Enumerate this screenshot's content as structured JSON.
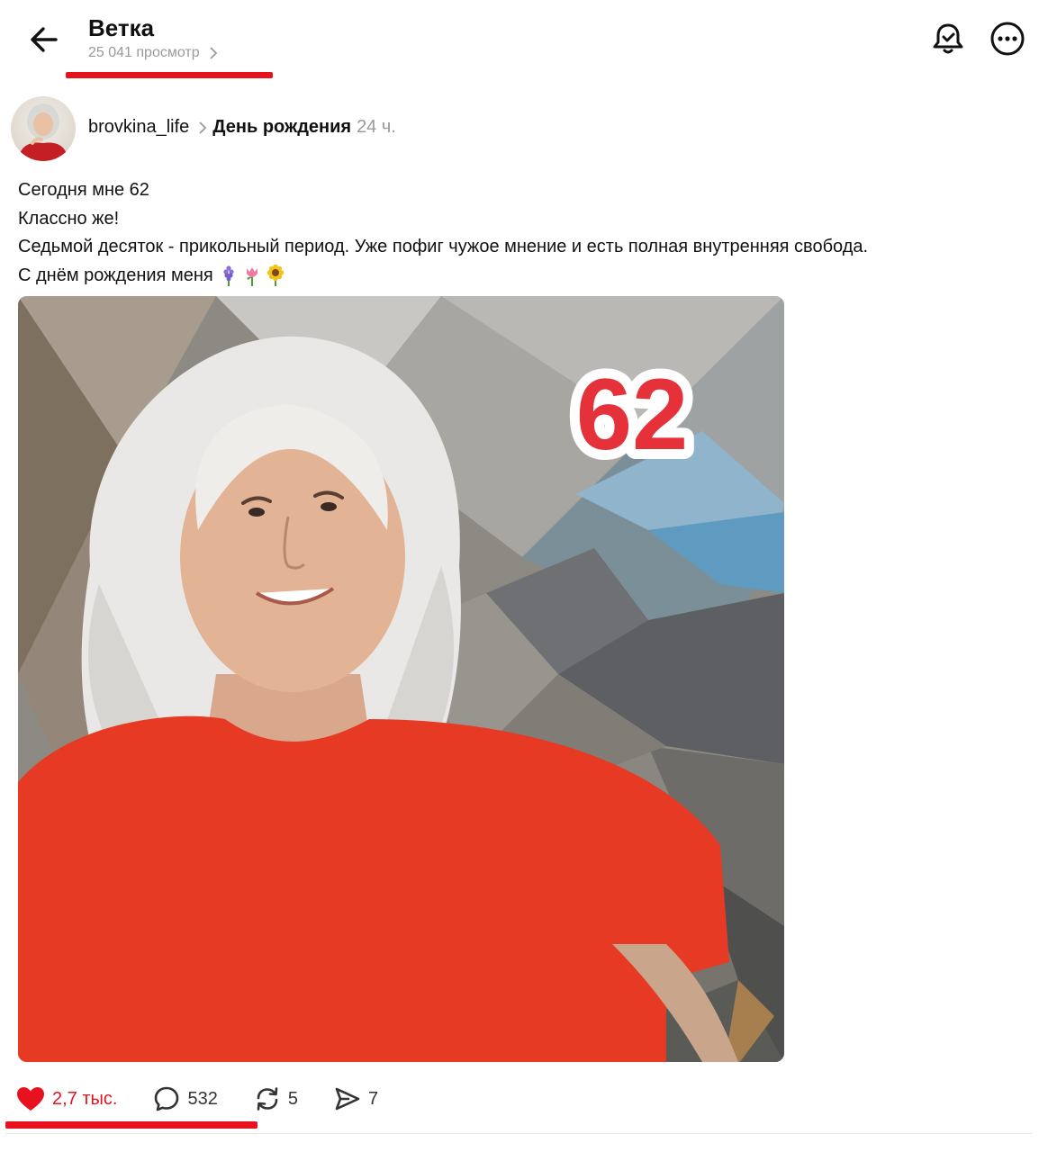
{
  "header": {
    "title": "Ветка",
    "views": "25 041 просмотр"
  },
  "post": {
    "author": "brovkina_life",
    "thread": "День рождения",
    "time": "24 ч.",
    "lines": [
      "Сегодня мне 62",
      "Классно же!",
      "Седьмой десяток - прикольный период. Уже пофиг чужое мнение и есть полная внутренняя свобода.",
      "С днём рождения меня"
    ],
    "emoji": [
      "hyacinth",
      "tulip",
      "sunflower"
    ],
    "image_number": "62"
  },
  "actions": {
    "likes": "2,7 тыс.",
    "comments": "532",
    "reposts": "5",
    "shares": "7"
  },
  "colors": {
    "accent": "#e8121e",
    "muted": "#9a9a9a",
    "shirt": "#e63a25"
  },
  "icons": [
    "back-arrow-icon",
    "chevron-right-icon",
    "bell-icon",
    "more-icon",
    "heart-icon",
    "comment-icon",
    "repost-icon",
    "send-icon"
  ]
}
